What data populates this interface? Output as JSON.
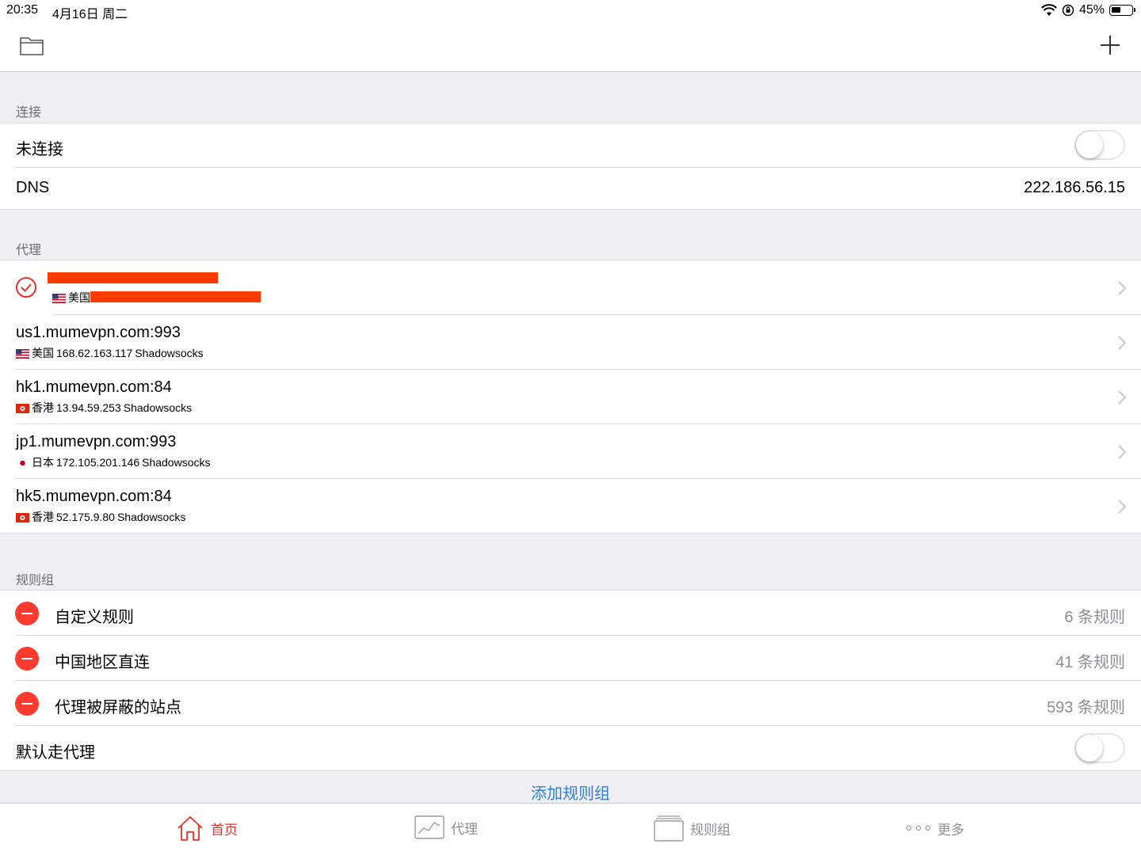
{
  "status_bar": {
    "time": "20:35",
    "date": "4月16日 周二",
    "battery": "45%"
  },
  "sections": {
    "connection": "连接",
    "proxy": "代理",
    "rules": "规则组"
  },
  "connection": {
    "status_label": "未连接",
    "connected": false,
    "dns_label": "DNS",
    "dns_value": "222.186.56.15"
  },
  "proxies": [
    {
      "title": "",
      "region": "美国",
      "address": "",
      "type": "",
      "selected": true,
      "redacted": true
    },
    {
      "title": "us1.mumevpn.com:993",
      "region": "美国",
      "address": "168.62.163.117",
      "type": "Shadowsocks",
      "flag": "us"
    },
    {
      "title": "hk1.mumevpn.com:84",
      "region": "香港",
      "address": "13.94.59.253",
      "type": "Shadowsocks",
      "flag": "hk"
    },
    {
      "title": "jp1.mumevpn.com:993",
      "region": "日本",
      "address": "172.105.201.146",
      "type": "Shadowsocks",
      "flag": "jp"
    },
    {
      "title": "hk5.mumevpn.com:84",
      "region": "香港",
      "address": "52.175.9.80",
      "type": "Shadowsocks",
      "flag": "hk"
    }
  ],
  "rule_groups": [
    {
      "name": "自定义规则",
      "count": "6 条规则"
    },
    {
      "name": "中国地区直连",
      "count": "41 条规则"
    },
    {
      "name": "代理被屏蔽的站点",
      "count": "593 条规则"
    }
  ],
  "default_proxy": {
    "label": "默认走代理",
    "enabled": false
  },
  "add_rule_group": "添加规则组",
  "tabs": [
    {
      "label": "首页",
      "icon": "home-icon",
      "active": true
    },
    {
      "label": "代理",
      "icon": "chart-icon",
      "active": false
    },
    {
      "label": "规则组",
      "icon": "stack-icon",
      "active": false
    },
    {
      "label": "更多",
      "icon": "more-icon",
      "active": false
    }
  ],
  "colors": {
    "accent": "#e8312a",
    "link": "#2f7fd3",
    "destructive": "#ff3b30",
    "redaction": "#ff3b00"
  }
}
